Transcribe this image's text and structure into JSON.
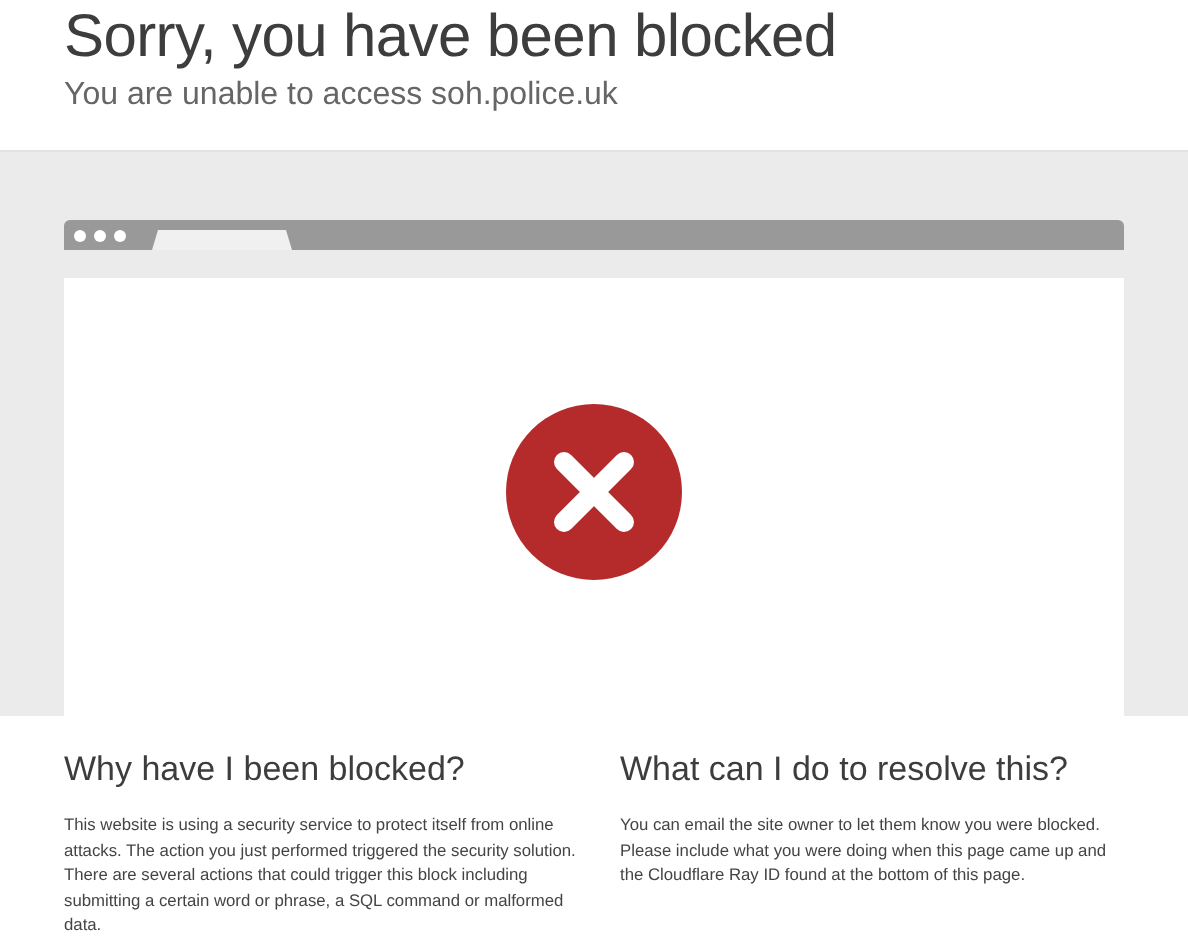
{
  "header": {
    "title": "Sorry, you have been blocked",
    "subtitle": "You are unable to access soh.police.uk"
  },
  "sections": [
    {
      "heading": "Why have I been blocked?",
      "text": "This website is using a security service to protect itself from online attacks. The action you just performed triggered the security solution. There are several actions that could trigger this block including submitting a certain word or phrase, a SQL command or malformed data."
    },
    {
      "heading": "What can I do to resolve this?",
      "text": "You can email the site owner to let them know you were blocked. Please include what you were doing when this page came up and the Cloudflare Ray ID found at the bottom of this page."
    }
  ]
}
